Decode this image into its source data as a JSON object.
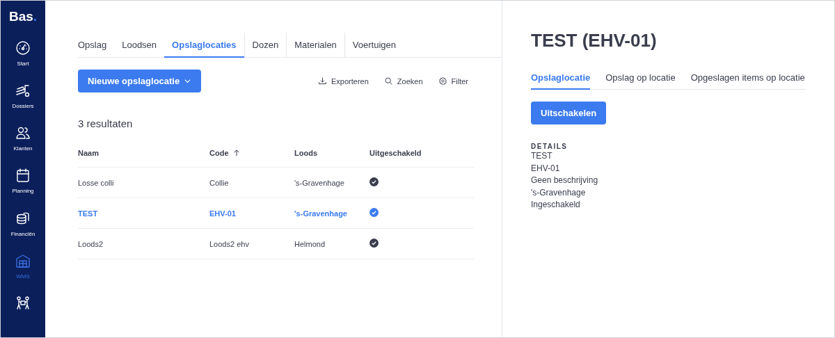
{
  "logo": {
    "text": "Bas",
    "dot": "."
  },
  "sidebar": {
    "items": [
      {
        "label": "Start",
        "selected": false
      },
      {
        "label": "Dossiers",
        "selected": false
      },
      {
        "label": "Klanten",
        "selected": false
      },
      {
        "label": "Planning",
        "selected": false
      },
      {
        "label": "Financiën",
        "selected": false
      },
      {
        "label": "WMS",
        "selected": true
      },
      {
        "selected": false
      }
    ]
  },
  "tabs": [
    {
      "label": "Opslag",
      "selected": false
    },
    {
      "label": "Loodsen",
      "selected": false
    },
    {
      "label": "Opslaglocaties",
      "selected": true
    },
    {
      "label": "Dozen",
      "selected": false
    },
    {
      "label": "Materialen",
      "selected": false
    },
    {
      "label": "Voertuigen",
      "selected": false
    }
  ],
  "toolbar": {
    "new_button": "Nieuwe opslaglocatie",
    "actions": [
      {
        "label": "Exporteren"
      },
      {
        "label": "Zoeken"
      },
      {
        "label": "Filter"
      }
    ]
  },
  "result_count": "3 resultaten",
  "table": {
    "columns": [
      {
        "label": "Naam",
        "sorted": false
      },
      {
        "label": "Code",
        "sorted": true
      },
      {
        "label": "Loods",
        "sorted": false
      },
      {
        "label": "Uitgeschakeld",
        "sorted": false
      }
    ],
    "rows": [
      {
        "name": "Losse colli",
        "code": "Collie",
        "loods": "'s-Gravenhage",
        "disabled": true,
        "selected": false
      },
      {
        "name": "TEST",
        "code": "EHV-01",
        "loods": "'s-Gravenhage",
        "disabled": true,
        "selected": true
      },
      {
        "name": "Loods2",
        "code": "Loods2 ehv",
        "loods": "Helmond",
        "disabled": true,
        "selected": false
      }
    ]
  },
  "detail": {
    "title": "TEST (EHV-01)",
    "tabs": [
      {
        "label": "Opslaglocatie",
        "selected": true
      },
      {
        "label": "Opslag op locatie",
        "selected": false
      },
      {
        "label": "Opgeslagen items op locatie",
        "selected": false
      }
    ],
    "button": "Uitschakelen",
    "section": "DETAILS",
    "lines": [
      "TEST",
      "EHV-01",
      "Geen beschrijving",
      "'s-Gravenhage",
      "Ingeschakeld"
    ]
  }
}
